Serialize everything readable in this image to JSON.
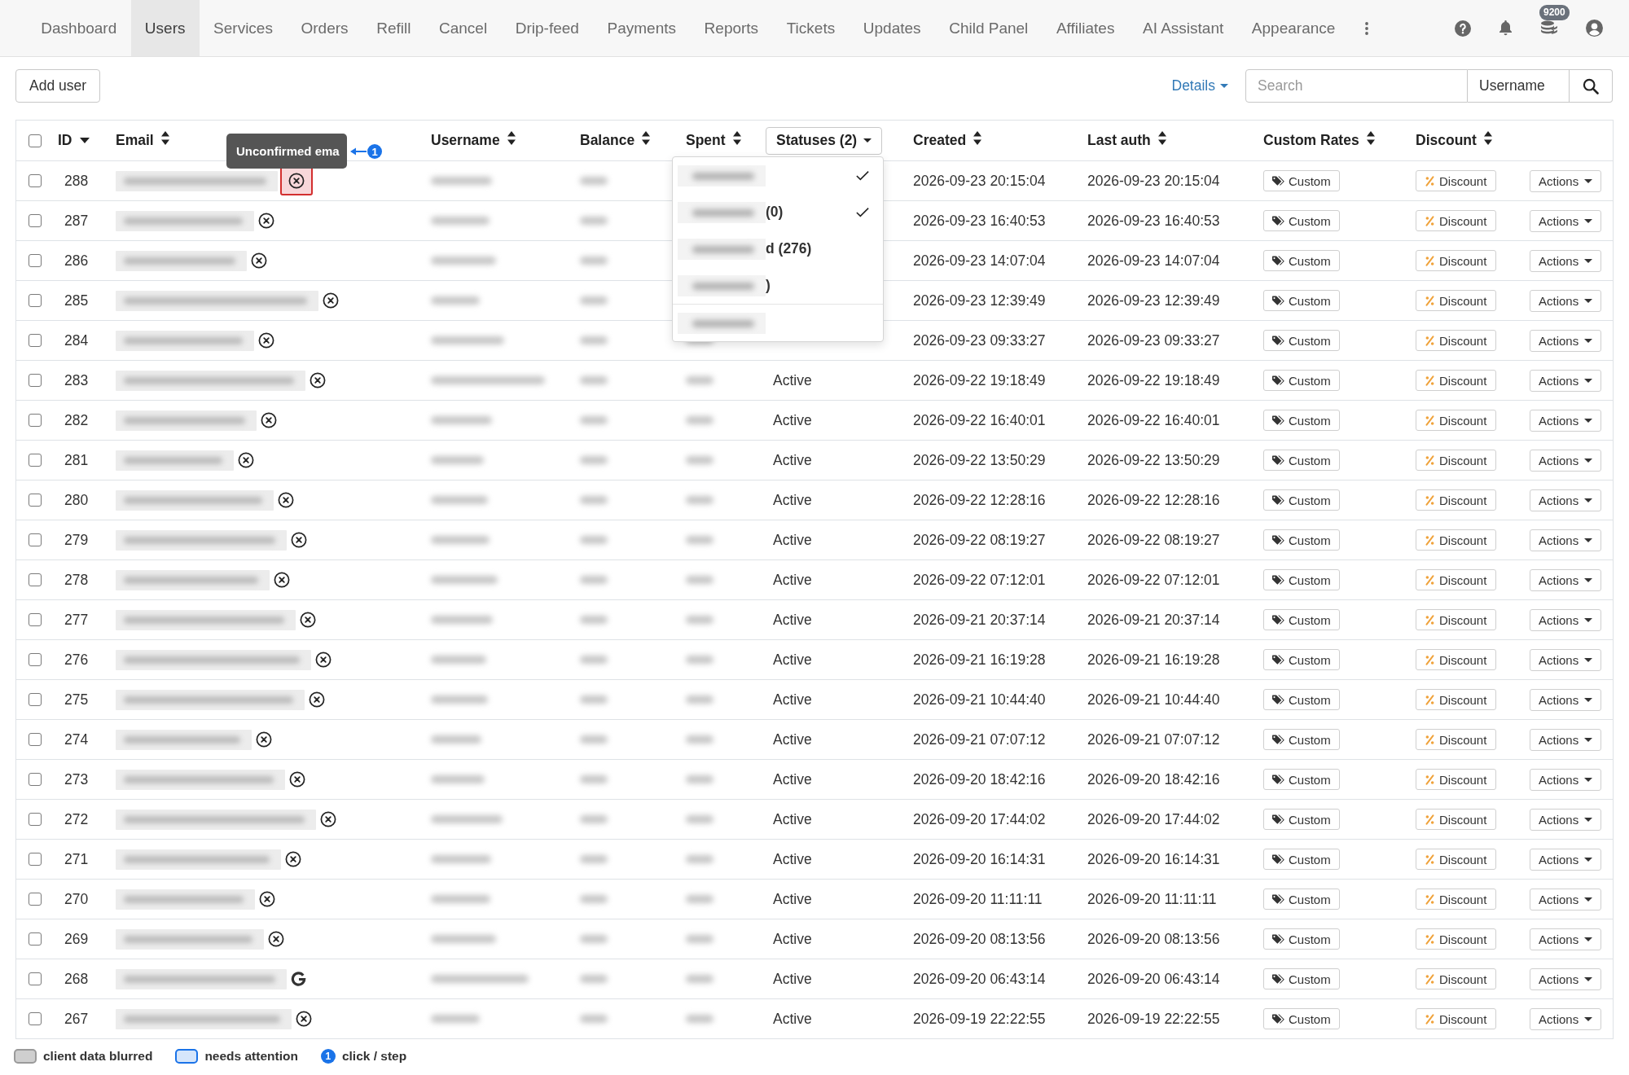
{
  "nav": {
    "tabs": [
      {
        "label": "Dashboard",
        "selected": false
      },
      {
        "label": "Users",
        "selected": true
      },
      {
        "label": "Services",
        "selected": false
      },
      {
        "label": "Orders",
        "selected": false
      },
      {
        "label": "Refill",
        "selected": false
      },
      {
        "label": "Cancel",
        "selected": false
      },
      {
        "label": "Drip-feed",
        "selected": false
      },
      {
        "label": "Payments",
        "selected": false
      },
      {
        "label": "Reports",
        "selected": false
      },
      {
        "label": "Tickets",
        "selected": false
      },
      {
        "label": "Updates",
        "selected": false
      },
      {
        "label": "Child Panel",
        "selected": false
      },
      {
        "label": "Affiliates",
        "selected": false
      },
      {
        "label": "AI Assistant",
        "selected": false
      },
      {
        "label": "Appearance",
        "selected": false
      }
    ],
    "balance_badge": "9200"
  },
  "toolbar": {
    "add_button": "Add user",
    "details_link": "Details",
    "search": {
      "placeholder": "Search"
    },
    "search_by": {
      "value": "Username"
    }
  },
  "table": {
    "all_checked": false,
    "columns": [
      {
        "label": "ID",
        "kind": "sortable",
        "sorted": true
      },
      {
        "label": "Email",
        "kind": "sortable",
        "sorted": false,
        "blurred": true
      },
      {
        "label": "Username",
        "kind": "sortable",
        "sorted": false,
        "blurred": true
      },
      {
        "label": "Balance",
        "kind": "sortable",
        "sorted": false,
        "blurred": true
      },
      {
        "label": "Spent",
        "kind": "sortable",
        "sorted": false,
        "blurred": true
      },
      {
        "label": "Statuses (2)",
        "kind": "filter",
        "expanded": true
      },
      {
        "label": "Created",
        "kind": "sortable",
        "sorted": false
      },
      {
        "label": "Last auth",
        "kind": "sortable",
        "sorted": false
      },
      {
        "label": "Custom Rates",
        "kind": "sortable",
        "sorted": false
      },
      {
        "label": "Discount",
        "kind": "sortable",
        "sorted": false
      }
    ],
    "tooltip": {
      "text": "Unconfirmed ema"
    },
    "annotation": {
      "step": "1"
    },
    "status_menu": {
      "items": [
        {
          "kind": "option",
          "blurred": true,
          "checked": true
        },
        {
          "kind": "option",
          "blurred": true,
          "text": "(0)",
          "checked": true
        },
        {
          "kind": "option",
          "blurred": true,
          "text": "d (276)",
          "checked": false
        },
        {
          "kind": "option",
          "blurred": true,
          "text": ")",
          "checked": false
        },
        {
          "kind": "divider"
        },
        {
          "kind": "action",
          "blurred": true
        }
      ]
    },
    "rows": [
      {
        "id": "288",
        "checked": false,
        "kind": "unconfirmed",
        "highlighted": true,
        "created": "2026-09-23 20:15:04",
        "last_auth": "2026-09-23 20:15:04",
        "custom": "Custom",
        "discount": "Discount",
        "actions": "Actions"
      },
      {
        "id": "287",
        "checked": false,
        "kind": "unconfirmed",
        "highlighted": false,
        "created": "2026-09-23 16:40:53",
        "last_auth": "2026-09-23 16:40:53",
        "custom": "Custom",
        "discount": "Discount",
        "actions": "Actions"
      },
      {
        "id": "286",
        "checked": false,
        "kind": "unconfirmed",
        "highlighted": false,
        "created": "2026-09-23 14:07:04",
        "last_auth": "2026-09-23 14:07:04",
        "custom": "Custom",
        "discount": "Discount",
        "actions": "Actions"
      },
      {
        "id": "285",
        "checked": false,
        "kind": "unconfirmed",
        "highlighted": false,
        "created": "2026-09-23 12:39:49",
        "last_auth": "2026-09-23 12:39:49",
        "custom": "Custom",
        "discount": "Discount",
        "actions": "Actions"
      },
      {
        "id": "284",
        "checked": false,
        "kind": "unconfirmed",
        "highlighted": false,
        "created": "2026-09-23 09:33:27",
        "last_auth": "2026-09-23 09:33:27",
        "custom": "Custom",
        "discount": "Discount",
        "actions": "Actions"
      },
      {
        "id": "283",
        "checked": false,
        "kind": "unconfirmed",
        "highlighted": false,
        "status": "Active",
        "created": "2026-09-22 19:18:49",
        "last_auth": "2026-09-22 19:18:49",
        "custom": "Custom",
        "discount": "Discount",
        "actions": "Actions"
      },
      {
        "id": "282",
        "checked": false,
        "kind": "unconfirmed",
        "highlighted": false,
        "status": "Active",
        "created": "2026-09-22 16:40:01",
        "last_auth": "2026-09-22 16:40:01",
        "custom": "Custom",
        "discount": "Discount",
        "actions": "Actions"
      },
      {
        "id": "281",
        "checked": false,
        "kind": "unconfirmed",
        "highlighted": false,
        "status": "Active",
        "created": "2026-09-22 13:50:29",
        "last_auth": "2026-09-22 13:50:29",
        "custom": "Custom",
        "discount": "Discount",
        "actions": "Actions"
      },
      {
        "id": "280",
        "checked": false,
        "kind": "unconfirmed",
        "highlighted": false,
        "status": "Active",
        "created": "2026-09-22 12:28:16",
        "last_auth": "2026-09-22 12:28:16",
        "custom": "Custom",
        "discount": "Discount",
        "actions": "Actions"
      },
      {
        "id": "279",
        "checked": false,
        "kind": "unconfirmed",
        "highlighted": false,
        "status": "Active",
        "created": "2026-09-22 08:19:27",
        "last_auth": "2026-09-22 08:19:27",
        "custom": "Custom",
        "discount": "Discount",
        "actions": "Actions"
      },
      {
        "id": "278",
        "checked": false,
        "kind": "unconfirmed",
        "highlighted": false,
        "status": "Active",
        "created": "2026-09-22 07:12:01",
        "last_auth": "2026-09-22 07:12:01",
        "custom": "Custom",
        "discount": "Discount",
        "actions": "Actions"
      },
      {
        "id": "277",
        "checked": false,
        "kind": "unconfirmed",
        "highlighted": false,
        "status": "Active",
        "created": "2026-09-21 20:37:14",
        "last_auth": "2026-09-21 20:37:14",
        "custom": "Custom",
        "discount": "Discount",
        "actions": "Actions"
      },
      {
        "id": "276",
        "checked": false,
        "kind": "unconfirmed",
        "highlighted": false,
        "status": "Active",
        "created": "2026-09-21 16:19:28",
        "last_auth": "2026-09-21 16:19:28",
        "custom": "Custom",
        "discount": "Discount",
        "actions": "Actions"
      },
      {
        "id": "275",
        "checked": false,
        "kind": "unconfirmed",
        "highlighted": false,
        "status": "Active",
        "created": "2026-09-21 10:44:40",
        "last_auth": "2026-09-21 10:44:40",
        "custom": "Custom",
        "discount": "Discount",
        "actions": "Actions"
      },
      {
        "id": "274",
        "checked": false,
        "kind": "unconfirmed",
        "highlighted": false,
        "status": "Active",
        "created": "2026-09-21 07:07:12",
        "last_auth": "2026-09-21 07:07:12",
        "custom": "Custom",
        "discount": "Discount",
        "actions": "Actions"
      },
      {
        "id": "273",
        "checked": false,
        "kind": "unconfirmed",
        "highlighted": false,
        "status": "Active",
        "created": "2026-09-20 18:42:16",
        "last_auth": "2026-09-20 18:42:16",
        "custom": "Custom",
        "discount": "Discount",
        "actions": "Actions"
      },
      {
        "id": "272",
        "checked": false,
        "kind": "unconfirmed",
        "highlighted": false,
        "status": "Active",
        "created": "2026-09-20 17:44:02",
        "last_auth": "2026-09-20 17:44:02",
        "custom": "Custom",
        "discount": "Discount",
        "actions": "Actions"
      },
      {
        "id": "271",
        "checked": false,
        "kind": "unconfirmed",
        "highlighted": false,
        "status": "Active",
        "created": "2026-09-20 16:14:31",
        "last_auth": "2026-09-20 16:14:31",
        "custom": "Custom",
        "discount": "Discount",
        "actions": "Actions"
      },
      {
        "id": "270",
        "checked": false,
        "kind": "unconfirmed",
        "highlighted": false,
        "status": "Active",
        "created": "2026-09-20 11:11:11",
        "last_auth": "2026-09-20 11:11:11",
        "custom": "Custom",
        "discount": "Discount",
        "actions": "Actions"
      },
      {
        "id": "269",
        "checked": false,
        "kind": "unconfirmed",
        "highlighted": false,
        "status": "Active",
        "created": "2026-09-20 08:13:56",
        "last_auth": "2026-09-20 08:13:56",
        "custom": "Custom",
        "discount": "Discount",
        "actions": "Actions"
      },
      {
        "id": "268",
        "checked": false,
        "kind": "google",
        "highlighted": false,
        "status": "Active",
        "created": "2026-09-20 06:43:14",
        "last_auth": "2026-09-20 06:43:14",
        "custom": "Custom",
        "discount": "Discount",
        "actions": "Actions"
      },
      {
        "id": "267",
        "checked": false,
        "kind": "unconfirmed",
        "highlighted": false,
        "status": "Active",
        "created": "2026-09-19 22:22:55",
        "last_auth": "2026-09-19 22:22:55",
        "custom": "Custom",
        "discount": "Discount",
        "actions": "Actions"
      }
    ]
  },
  "legend": [
    {
      "kind": "blurred",
      "label": "client data blurred"
    },
    {
      "kind": "attention",
      "label": "needs attention"
    },
    {
      "kind": "step",
      "marker": "1",
      "label": "click / step"
    }
  ]
}
